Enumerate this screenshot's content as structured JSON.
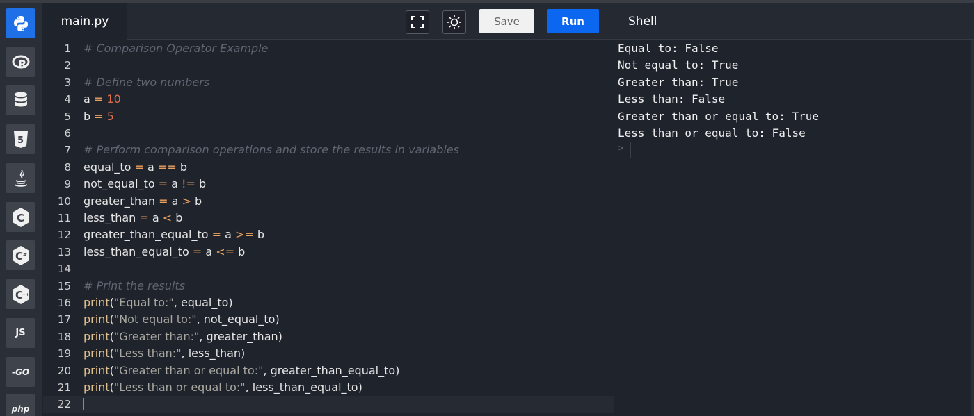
{
  "sidebar": {
    "languages": [
      {
        "id": "python",
        "icon": "python-icon",
        "label": "",
        "active": true
      },
      {
        "id": "r",
        "icon": "r-icon",
        "label": "R"
      },
      {
        "id": "sql",
        "icon": "database-icon",
        "label": ""
      },
      {
        "id": "html",
        "icon": "html5-icon",
        "label": "5"
      },
      {
        "id": "java",
        "icon": "java-icon",
        "label": ""
      },
      {
        "id": "c",
        "icon": "c-icon",
        "label": "C"
      },
      {
        "id": "csharp",
        "icon": "csharp-icon",
        "label": "C"
      },
      {
        "id": "cpp",
        "icon": "cpp-icon",
        "label": "C"
      },
      {
        "id": "js",
        "icon": "js-icon",
        "label": "JS"
      },
      {
        "id": "go",
        "icon": "go-icon",
        "label": "-GO"
      },
      {
        "id": "php",
        "icon": "php-icon",
        "label": "php"
      }
    ]
  },
  "header": {
    "file_tab": "main.py",
    "save_label": "Save",
    "run_label": "Run",
    "shell_title": "Shell"
  },
  "editor": {
    "lines": [
      {
        "n": "1",
        "text": "# Comparison Operator Example"
      },
      {
        "n": "2",
        "text": ""
      },
      {
        "n": "3",
        "text": "# Define two numbers"
      },
      {
        "n": "4",
        "text": "a = 10"
      },
      {
        "n": "5",
        "text": "b = 5"
      },
      {
        "n": "6",
        "text": ""
      },
      {
        "n": "7",
        "text": "# Perform comparison operations and store the results in variables"
      },
      {
        "n": "8",
        "text": "equal_to = a == b"
      },
      {
        "n": "9",
        "text": "not_equal_to = a != b"
      },
      {
        "n": "10",
        "text": "greater_than = a > b"
      },
      {
        "n": "11",
        "text": "less_than = a < b"
      },
      {
        "n": "12",
        "text": "greater_than_equal_to = a >= b"
      },
      {
        "n": "13",
        "text": "less_than_equal_to = a <= b"
      },
      {
        "n": "14",
        "text": ""
      },
      {
        "n": "15",
        "text": "# Print the results"
      },
      {
        "n": "16",
        "text": "print(\"Equal to:\", equal_to)"
      },
      {
        "n": "17",
        "text": "print(\"Not equal to:\", not_equal_to)"
      },
      {
        "n": "18",
        "text": "print(\"Greater than:\", greater_than)"
      },
      {
        "n": "19",
        "text": "print(\"Less than:\", less_than)"
      },
      {
        "n": "20",
        "text": "print(\"Greater than or equal to:\", greater_than_equal_to)"
      },
      {
        "n": "21",
        "text": "print(\"Less than or equal to:\", less_than_equal_to)"
      },
      {
        "n": "22",
        "text": ""
      }
    ],
    "current_line": "22"
  },
  "shell": {
    "output": [
      "Equal to: False",
      "Not equal to: True",
      "Greater than: True",
      "Less than: False",
      "Greater than or equal to: True",
      "Less than or equal to: False"
    ],
    "prompt": ">"
  },
  "colors": {
    "accent": "#0b67f0",
    "background": "#1f232c",
    "comment": "#5f6672",
    "number": "#e06c4c",
    "operator": "#e8a060",
    "string": "#a7a7a0",
    "function": "#e2c08d"
  }
}
